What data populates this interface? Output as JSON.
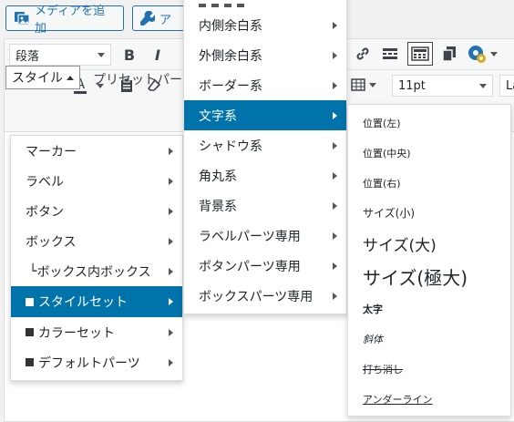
{
  "top_buttons": {
    "add_media": "メディアを追加",
    "second": "ア"
  },
  "toolbar": {
    "format_select": "段落",
    "font_size": "11pt",
    "font_family_partial": "La"
  },
  "style_button": "スタイル",
  "preset_text": "プリセットパー",
  "menu_level1": [
    {
      "label": "マーカー",
      "prefix": "",
      "has_sub": true
    },
    {
      "label": "ラベル",
      "prefix": "",
      "has_sub": true
    },
    {
      "label": "ボタン",
      "prefix": "",
      "has_sub": true
    },
    {
      "label": "ボックス",
      "prefix": "",
      "has_sub": true
    },
    {
      "label": "ボックス内ボックス",
      "prefix": "└",
      "has_sub": true
    },
    {
      "label": "スタイルセット",
      "prefix": "■",
      "has_sub": true,
      "selected": true
    },
    {
      "label": "カラーセット",
      "prefix": "■",
      "has_sub": true
    },
    {
      "label": "デフォルトパーツ",
      "prefix": "■",
      "has_sub": true
    }
  ],
  "menu_level2": [
    {
      "label": "内側余白系"
    },
    {
      "label": "外側余白系"
    },
    {
      "label": "ボーダー系"
    },
    {
      "label": "文字系",
      "selected": true
    },
    {
      "label": "シャドウ系"
    },
    {
      "label": "角丸系"
    },
    {
      "label": "背景系"
    },
    {
      "label": "ラベルパーツ専用"
    },
    {
      "label": "ボタンパーツ専用"
    },
    {
      "label": "ボックスパーツ専用"
    }
  ],
  "menu_level3": [
    {
      "label": "位置(左)",
      "style": "small"
    },
    {
      "label": "位置(中央)",
      "style": "small"
    },
    {
      "label": "位置(右)",
      "style": "small"
    },
    {
      "label": "サイズ(小)",
      "style": "small"
    },
    {
      "label": "サイズ(大)",
      "style": "large"
    },
    {
      "label": "サイズ(極大)",
      "style": "xlarge"
    },
    {
      "label": "太字",
      "style": "bold"
    },
    {
      "label": "斜体",
      "style": "italic"
    },
    {
      "label": "打ち消し",
      "style": "strike"
    },
    {
      "label": "アンダーライン",
      "style": "underline"
    }
  ],
  "colors": {
    "selected_bg": "#0073aa",
    "accent": "#2271b1"
  }
}
